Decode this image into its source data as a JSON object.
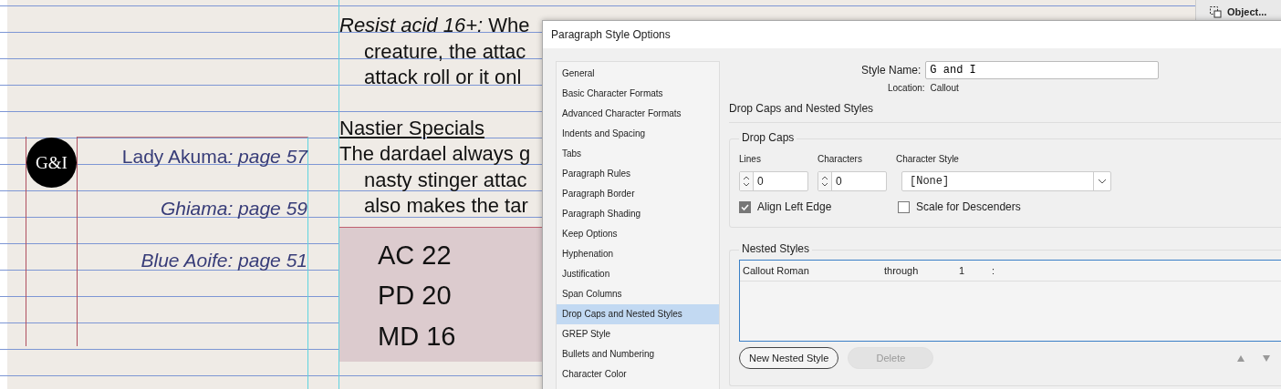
{
  "document": {
    "logo": "G&I",
    "callouts": [
      {
        "name": "Lady Akuma",
        "name_italic": false,
        "page": ": page 57"
      },
      {
        "name": "Ghiama",
        "name_italic": true,
        "page": ": page 59"
      },
      {
        "name": "Blue Aoife",
        "name_italic": true,
        "page": ": page 51"
      }
    ],
    "body": [
      {
        "text": "*Resist acid 16+:* Whe",
        "kind": "first"
      },
      {
        "text": "creature, the attac",
        "kind": "cont"
      },
      {
        "text": "attack roll or it onl",
        "kind": "cont"
      },
      {
        "text": "Nastier Specials",
        "kind": "heading"
      },
      {
        "text": "The dardael always g",
        "kind": "first"
      },
      {
        "text": "nasty stinger attac",
        "kind": "cont"
      },
      {
        "text": "also makes the tar",
        "kind": "cont"
      }
    ],
    "stats": [
      "AC 22",
      "PD 20",
      "MD 16"
    ]
  },
  "object_button": "Object...",
  "dialog": {
    "title": "Paragraph Style Options",
    "sidebar": [
      {
        "label": "General",
        "selected": false
      },
      {
        "label": "Basic Character Formats",
        "selected": false
      },
      {
        "label": "Advanced Character Formats",
        "selected": false
      },
      {
        "label": "Indents and Spacing",
        "selected": false
      },
      {
        "label": "Tabs",
        "selected": false
      },
      {
        "label": "Paragraph Rules",
        "selected": false
      },
      {
        "label": "Paragraph Border",
        "selected": false
      },
      {
        "label": "Paragraph Shading",
        "selected": false
      },
      {
        "label": "Keep Options",
        "selected": false
      },
      {
        "label": "Hyphenation",
        "selected": false
      },
      {
        "label": "Justification",
        "selected": false
      },
      {
        "label": "Span Columns",
        "selected": false
      },
      {
        "label": "Drop Caps and Nested Styles",
        "selected": true
      },
      {
        "label": "GREP Style",
        "selected": false
      },
      {
        "label": "Bullets and Numbering",
        "selected": false
      },
      {
        "label": "Character Color",
        "selected": false
      }
    ],
    "style_name": {
      "label": "Style Name:",
      "value": "G and I"
    },
    "location": {
      "label": "Location:",
      "value": "Callout"
    },
    "section_title": "Drop Caps and Nested Styles",
    "drop_caps": {
      "legend": "Drop Caps",
      "lines": {
        "label": "Lines",
        "value": "0"
      },
      "characters": {
        "label": "Characters",
        "value": "0"
      },
      "character_style": {
        "label": "Character Style",
        "value": "[None]"
      },
      "align_left_edge": {
        "label": "Align Left Edge",
        "checked": true
      },
      "scale_for_descenders": {
        "label": "Scale for Descenders",
        "checked": false
      }
    },
    "nested_styles": {
      "legend": "Nested Styles",
      "rows": [
        {
          "style": "Callout Roman",
          "mode": "through",
          "count": "1",
          "delimiter": ":"
        }
      ]
    },
    "buttons": [
      {
        "label": "New Nested Style",
        "disabled": false
      },
      {
        "label": "Delete",
        "disabled": true
      }
    ]
  }
}
